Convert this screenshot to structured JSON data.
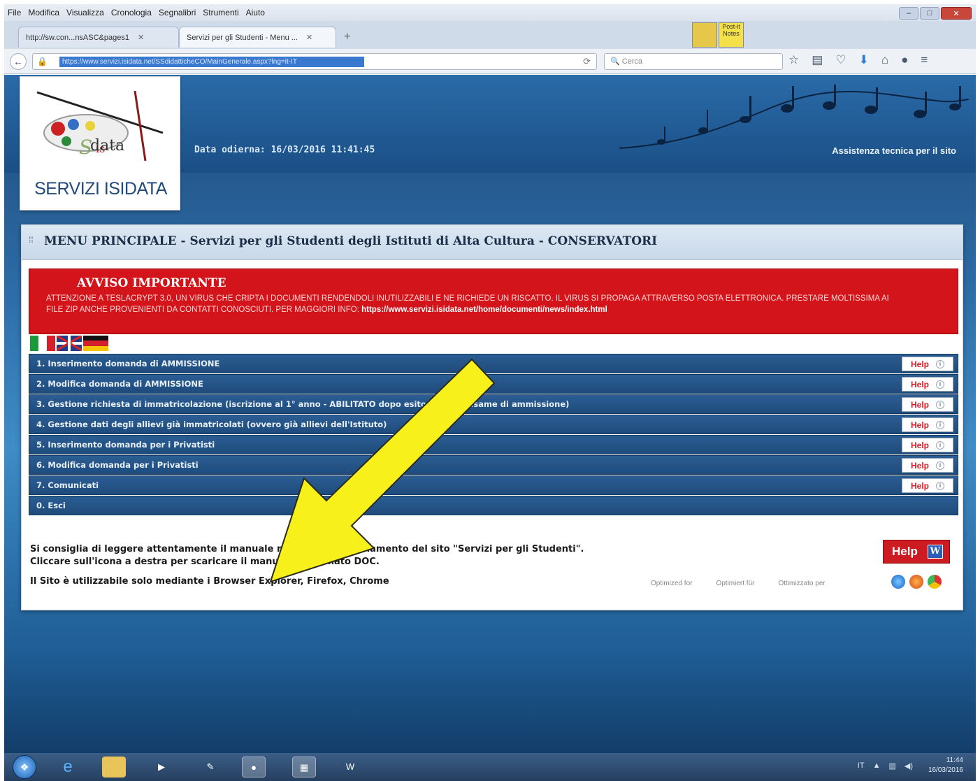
{
  "browser": {
    "menu": [
      "File",
      "Modifica",
      "Visualizza",
      "Cronologia",
      "Segnalibri",
      "Strumenti",
      "Aiuto"
    ],
    "window_controls": [
      "–",
      "□",
      "✕"
    ],
    "tabs": [
      {
        "label": "http://sw.con...nsASC&pages1"
      },
      {
        "label": "Servizi per gli Studenti - Menu ..."
      }
    ],
    "url": "https://www.servizi.isidata.net/SSdidatticheCO/MainGenerale.aspx?lng=it-IT",
    "search_placeholder": "Cerca",
    "sticky_notes_label": "Post-it Notes",
    "new_tab_symbol": "+",
    "close_symbol": "✕"
  },
  "header": {
    "logo_word": "data",
    "logo_title": "SERVIZI ISIDATA",
    "date_text": "Data odierna: 16/03/2016 11:41:45",
    "assist_text": "Assistenza tecnica per il sito"
  },
  "panel": {
    "title": "MENU PRINCIPALE - Servizi per gli Studenti degli Istituti di Alta Cultura - CONSERVATORI"
  },
  "alert": {
    "title": "AVVISO IMPORTANTE",
    "text": "ATTENZIONE A TESLACRYPT 3.0, UN VIRUS CHE CRIPTA I DOCUMENTI RENDENDOLI INUTILIZZABILI E NE RICHIEDE UN RISCATTO. IL VIRUS SI PROPAGA ATTRAVERSO POSTA ELETTRONICA. PRESTARE MOLTISSIMA AI FILE ZIP ANCHE PROVENIENTI DA CONTATTI CONOSCIUTI. PER MAGGIORI INFO:",
    "link": "https://www.servizi.isidata.net/home/documenti/news/index.html"
  },
  "menu_items": [
    {
      "label": "1. Inserimento domanda di AMMISSIONE",
      "help": "Help"
    },
    {
      "label": "2. Modifica domanda di AMMISSIONE",
      "help": "Help"
    },
    {
      "label": "3. Gestione richiesta di immatricolazione (iscrizione al 1° anno - ABILITATO dopo esito positivo esame di ammissione)",
      "help": "Help"
    },
    {
      "label": "4. Gestione dati degli allievi già immatricolati (ovvero già allievi dell'Istituto)",
      "help": "Help"
    },
    {
      "label": "5. Inserimento domanda per i Privatisti",
      "help": "Help"
    },
    {
      "label": "6. Modifica domanda per i Privatisti",
      "help": "Help"
    },
    {
      "label": "7. Comunicati",
      "help": "Help"
    },
    {
      "label": "0. Esci",
      "help": ""
    }
  ],
  "footer": {
    "note_line1": "Si consiglia di leggere attentamente il manuale relativo al funzionamento del sito \"Servizi per gli Studenti\".",
    "note_line2": "Cliccare sull'icona a destra per scaricare il manuale in formato DOC.",
    "browser_note": "Il Sito è utilizzabile solo mediante i Browser Explorer, Firefox, Chrome",
    "optimized": [
      "Optimized for",
      "Optimiert für",
      "Ottimizzato per"
    ],
    "help_label": "Help",
    "word_letter": "W"
  },
  "taskbar": {
    "time": "11:44",
    "date": "16/03/2016",
    "lang": "IT"
  },
  "colors": {
    "alert_red": "#d4141b",
    "menu_blue": "#2b5d93",
    "page_blue": "#2c6aa4",
    "arrow_yellow": "#f7f01a"
  }
}
